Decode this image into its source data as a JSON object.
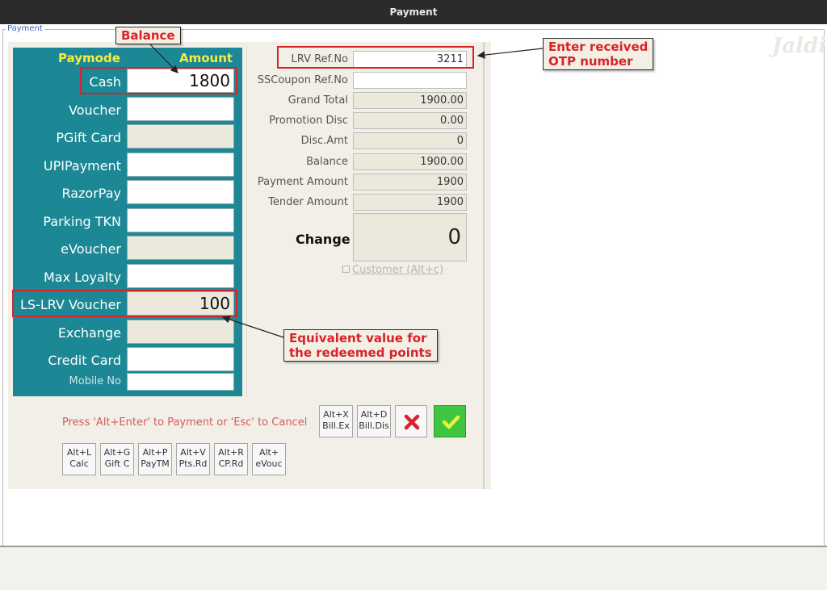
{
  "window": {
    "title": "Payment",
    "group_label": "Payment",
    "watermark": "Jaldi"
  },
  "paymodes": {
    "header_mode": "Paymode",
    "header_amount": "Amount",
    "rows": [
      {
        "label": "Cash",
        "value": "1800"
      },
      {
        "label": "Voucher",
        "value": ""
      },
      {
        "label": "PGift Card",
        "value": ""
      },
      {
        "label": "UPIPayment",
        "value": ""
      },
      {
        "label": "RazorPay",
        "value": ""
      },
      {
        "label": "Parking TKN",
        "value": ""
      },
      {
        "label": "eVoucher",
        "value": ""
      },
      {
        "label": "Max Loyalty",
        "value": ""
      },
      {
        "label": "LS-LRV Voucher",
        "value": "100"
      },
      {
        "label": "Exchange",
        "value": ""
      },
      {
        "label": "Credit Card",
        "value": ""
      }
    ],
    "mobile_label": "Mobile No",
    "mobile_value": ""
  },
  "summary": {
    "fields": [
      {
        "label": "LRV Ref.No",
        "value": "3211"
      },
      {
        "label": "SSCoupon Ref.No",
        "value": ""
      },
      {
        "label": "Grand Total",
        "value": "1900.00"
      },
      {
        "label": "Promotion Disc",
        "value": "0.00"
      },
      {
        "label": "Disc.Amt",
        "value": "0"
      },
      {
        "label": "Balance",
        "value": "1900.00"
      },
      {
        "label": "Payment Amount",
        "value": "1900"
      },
      {
        "label": "Tender Amount",
        "value": "1900"
      }
    ],
    "change_label": "Change",
    "change_value": "0",
    "customer_label": "Customer (Alt+c)"
  },
  "actions": {
    "hint": "Press 'Alt+Enter' to Payment or 'Esc' to Cancel",
    "top_buttons": [
      {
        "line1": "Alt+X",
        "line2": "Bill.Ex"
      },
      {
        "line1": "Alt+D",
        "line2": "Bill.Dis"
      }
    ],
    "bottom_buttons": [
      {
        "line1": "Alt+L",
        "line2": "Calc"
      },
      {
        "line1": "Alt+G",
        "line2": "Gift C"
      },
      {
        "line1": "Alt+P",
        "line2": "PayTM"
      },
      {
        "line1": "Alt+V",
        "line2": "Pts.Rd"
      },
      {
        "line1": "Alt+R",
        "line2": "CP.Rd"
      },
      {
        "line1": "Alt+",
        "line2": "eVouc"
      }
    ],
    "cancel_icon": "cross-icon",
    "ok_icon": "checkmark-icon"
  },
  "annotations": {
    "balance": "Balance",
    "otp_line1": "Enter received",
    "otp_line2": "OTP number",
    "equiv_line1": "Equivalent value for",
    "equiv_line2": "the redeemed points",
    "color": "#d8232a"
  }
}
